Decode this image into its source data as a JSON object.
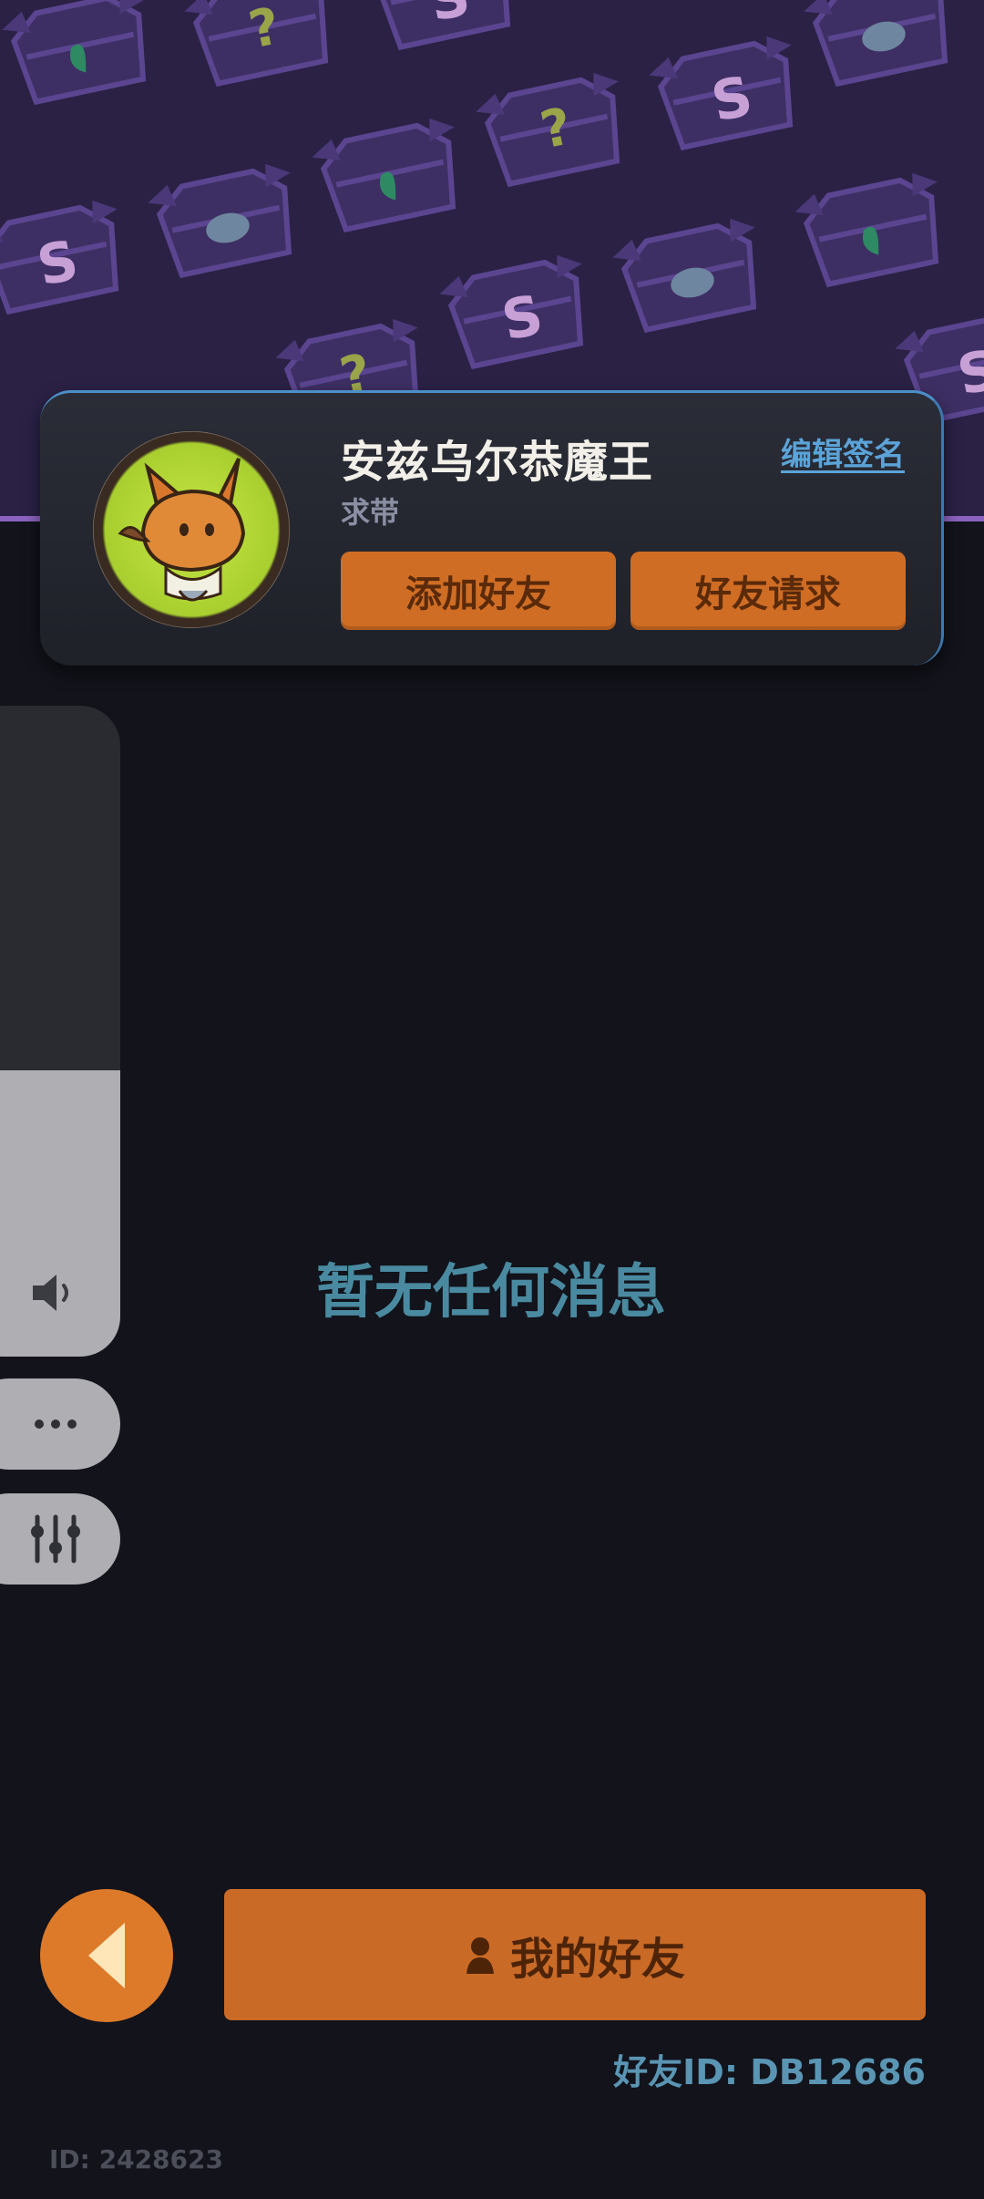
{
  "profile": {
    "username": "安兹乌尔恭魔王",
    "signature": "求带",
    "edit_signature_label": "编辑签名",
    "add_friend_label": "添加好友",
    "friend_requests_label": "好友请求"
  },
  "side_toolbar": {
    "volume_level_fraction": 0.44,
    "volume_icon": "speaker-icon",
    "more_icon": "more-dots-icon",
    "settings_icon": "equalizer-icon"
  },
  "messages": {
    "empty_text": "暂无任何消息"
  },
  "footer": {
    "back_icon": "back-arrow-icon",
    "my_friends_label": "我的好友",
    "friend_id_text": "好友ID: DB12686",
    "user_id_text": "ID: 2428623"
  },
  "colors": {
    "accent_orange": "#d06d24",
    "banner_purple": "#2a2145",
    "background": "#12131b",
    "link_blue": "#5ba3d8",
    "empty_text_teal": "#4a8aa0"
  }
}
